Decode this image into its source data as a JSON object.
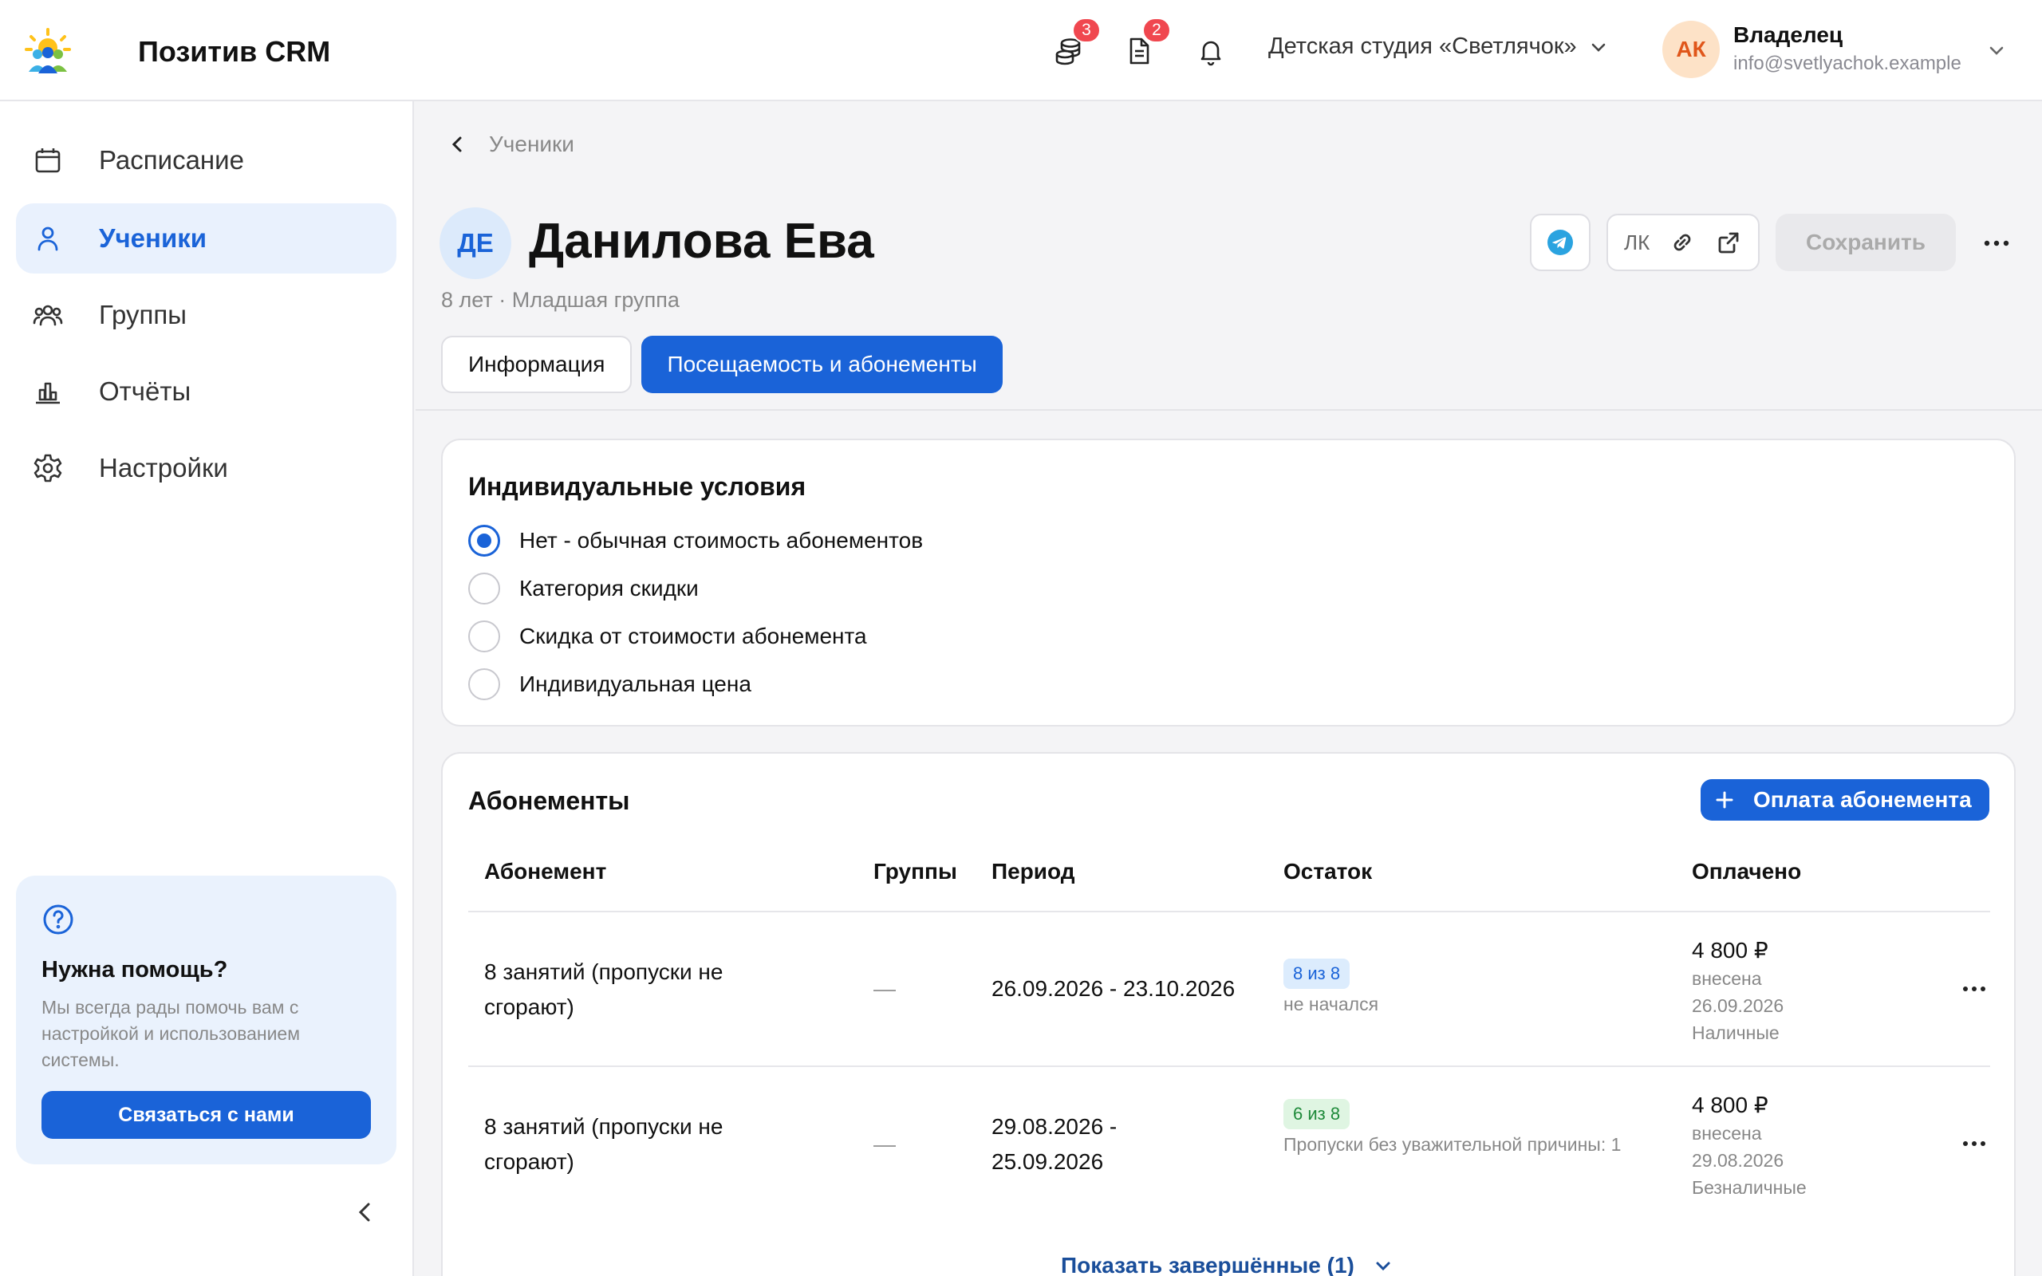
{
  "app": {
    "name": "Позитив CRM",
    "org_name": "Детская студия «Светлячок»",
    "user": {
      "initials": "АК",
      "name": "Владелец",
      "email": "info@svetlyachok.example"
    },
    "badges": {
      "payments": "3",
      "documents": "2"
    }
  },
  "sidebar": {
    "items": [
      {
        "label": "Расписание",
        "icon": "calendar-icon"
      },
      {
        "label": "Ученики",
        "icon": "user-icon",
        "active": true
      },
      {
        "label": "Группы",
        "icon": "users-icon"
      },
      {
        "label": "Отчёты",
        "icon": "chart-icon"
      },
      {
        "label": "Настройки",
        "icon": "gear-icon"
      }
    ],
    "help": {
      "title": "Нужна помощь?",
      "text": "Мы всегда рады помочь вам с настройкой и использованием системы.",
      "button": "Связаться с нами"
    }
  },
  "breadcrumb": "Ученики",
  "student": {
    "initials": "ДЕ",
    "name": "Данилова Ева",
    "meta": "8 лет · Младшая группа"
  },
  "actions": {
    "lk_label": "ЛК",
    "save": "Сохранить"
  },
  "tabs": [
    {
      "label": "Информация",
      "active": false
    },
    {
      "label": "Посещаемость и абонементы",
      "active": true
    }
  ],
  "conditions": {
    "title": "Индивидуальные условия",
    "options": [
      {
        "label": "Нет - обычная стоимость абонементов",
        "selected": true
      },
      {
        "label": "Категория скидки",
        "selected": false
      },
      {
        "label": "Скидка от стоимости абонемента",
        "selected": false
      },
      {
        "label": "Индивидуальная цена",
        "selected": false
      }
    ]
  },
  "subscriptions": {
    "title": "Абонементы",
    "pay_button": "Оплата абонемента",
    "columns": [
      "Абонемент",
      "Группы",
      "Период",
      "Остаток",
      "Оплачено"
    ],
    "rows": [
      {
        "name": "8 занятий (пропуски не сгорают)",
        "groups": "—",
        "period": "26.09.2026 - 23.10.2026",
        "remaining": "8 из 8",
        "status": "не начался",
        "amount": "4 800 ₽",
        "paid_label": "внесена",
        "paid_date": "26.09.2026",
        "method": "Наличные"
      },
      {
        "name": "8 занятий (пропуски не сгорают)",
        "groups": "—",
        "period": "29.08.2026 - 25.09.2026",
        "remaining": "6 из 8",
        "status": "Пропуски без уважительной причины: 1",
        "amount": "4 800 ₽",
        "paid_label": "внесена",
        "paid_date": "29.08.2026",
        "method": "Безналичные"
      }
    ],
    "show_completed": "Показать завершённые (1)"
  },
  "colors": {
    "accent": "#1a63d8",
    "accent_light": "#e9f1fd",
    "badge": "#f0474f",
    "success_bg": "#dff5e2",
    "success_text": "#1e8a3a"
  }
}
